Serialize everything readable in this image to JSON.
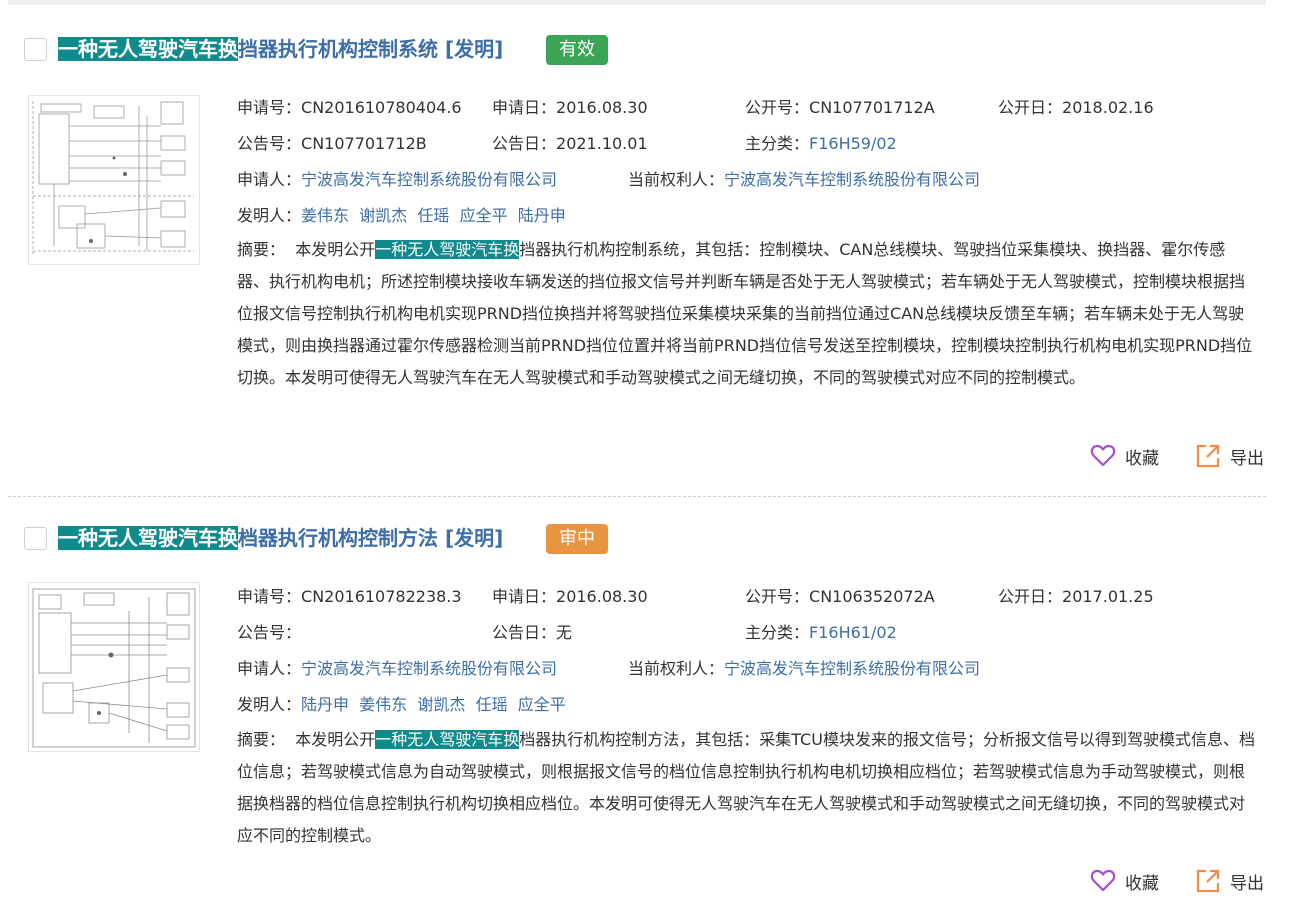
{
  "labels": {
    "app_no": "申请号：",
    "app_date": "申请日：",
    "pub_no": "公开号：",
    "pub_date": "公开日：",
    "grant_no": "公告号：",
    "grant_date": "公告日：",
    "main_class": "主分类：",
    "applicant": "申请人：",
    "owner": "当前权利人：",
    "inventor": "发明人：",
    "abstract": "摘要："
  },
  "actions": {
    "favorite": "收藏",
    "export": "导出"
  },
  "colors": {
    "valid": "#3aa655",
    "pending": "#e89542",
    "link": "#3d6ea6",
    "highlight": "#0f8a8d"
  },
  "records": [
    {
      "title_hl": "一种无人驾驶汽车换",
      "title_rest": "挡器执行机构控制系统 [发明]",
      "status": "有效",
      "app_no": "CN201610780404.6",
      "app_date": "2016.08.30",
      "pub_no": "CN107701712A",
      "pub_date": "2018.02.16",
      "grant_no": "CN107701712B",
      "grant_date": "2021.10.01",
      "main_class": "F16H59/02",
      "applicant": "宁波高发汽车控制系统股份有限公司",
      "owner": "宁波高发汽车控制系统股份有限公司",
      "inventors": [
        "姜伟东",
        "谢凯杰",
        "任瑶",
        "应全平",
        "陆丹申"
      ],
      "abstract_pre": "本发明公开",
      "abstract_hl": "一种无人驾驶汽车换",
      "abstract_post": "挡器执行机构控制系统，其包括：控制模块、CAN总线模块、驾驶挡位采集模块、换挡器、霍尔传感器、执行机构电机；所述控制模块接收车辆发送的挡位报文信号并判断车辆是否处于无人驾驶模式；若车辆处于无人驾驶模式，控制模块根据挡位报文信号控制执行机构电机实现PRND挡位换挡并将驾驶挡位采集模块采集的当前挡位通过CAN总线模块反馈至车辆；若车辆未处于无人驾驶模式，则由换挡器通过霍尔传感器检测当前PRND挡位位置并将当前PRND挡位信号发送至控制模块，控制模块控制执行机构电机实现PRND挡位切换。本发明可使得无人驾驶汽车在无人驾驶模式和手动驾驶模式之间无缝切换，不同的驾驶模式对应不同的控制模式。"
    },
    {
      "title_hl": "一种无人驾驶汽车换",
      "title_rest": "档器执行机构控制方法 [发明]",
      "status": "审中",
      "app_no": "CN201610782238.3",
      "app_date": "2016.08.30",
      "pub_no": "CN106352072A",
      "pub_date": "2017.01.25",
      "grant_no": "",
      "grant_date": "无",
      "main_class": "F16H61/02",
      "applicant": "宁波高发汽车控制系统股份有限公司",
      "owner": "宁波高发汽车控制系统股份有限公司",
      "inventors": [
        "陆丹申",
        "姜伟东",
        "谢凯杰",
        "任瑶",
        "应全平"
      ],
      "abstract_pre": "本发明公开",
      "abstract_hl": "一种无人驾驶汽车换",
      "abstract_post": "档器执行机构控制方法，其包括：采集TCU模块发来的报文信号；分析报文信号以得到驾驶模式信息、档位信息；若驾驶模式信息为自动驾驶模式，则根据报文信号的档位信息控制执行机构电机切换相应档位；若驾驶模式信息为手动驾驶模式，则根据换档器的档位信息控制执行机构切换相应档位。本发明可使得无人驾驶汽车在无人驾驶模式和手动驾驶模式之间无缝切换，不同的驾驶模式对应不同的控制模式。"
    }
  ]
}
